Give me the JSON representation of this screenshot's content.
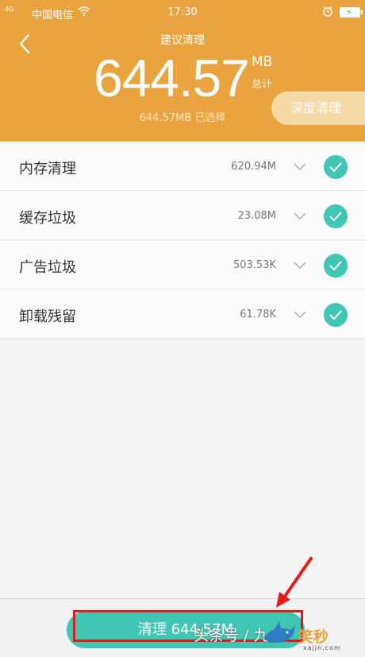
{
  "status_bar": {
    "signal": "4G",
    "carrier": "中国电信",
    "time": "17:30"
  },
  "header": {
    "title": "建议清理",
    "total_value": "644.57",
    "total_unit": "MB",
    "total_label": "总计",
    "selected_text": "644.57MB 已选择",
    "deep_clean_label": "深度清理"
  },
  "items": [
    {
      "label": "内存清理",
      "size": "620.94M",
      "checked": true
    },
    {
      "label": "缓存垃圾",
      "size": "23.08M",
      "checked": true
    },
    {
      "label": "广告垃圾",
      "size": "503.53K",
      "checked": true
    },
    {
      "label": "卸载残留",
      "size": "61.78K",
      "checked": true
    }
  ],
  "bottom": {
    "clean_button_label": "清理 644.57M"
  },
  "watermark": {
    "text": "头条号 / 九大",
    "logo_text": "笑秒",
    "url": "xajjn.com"
  },
  "colors": {
    "header": "#e9a43f",
    "accent": "#3fc7b4",
    "annotation": "#e21b1b"
  }
}
